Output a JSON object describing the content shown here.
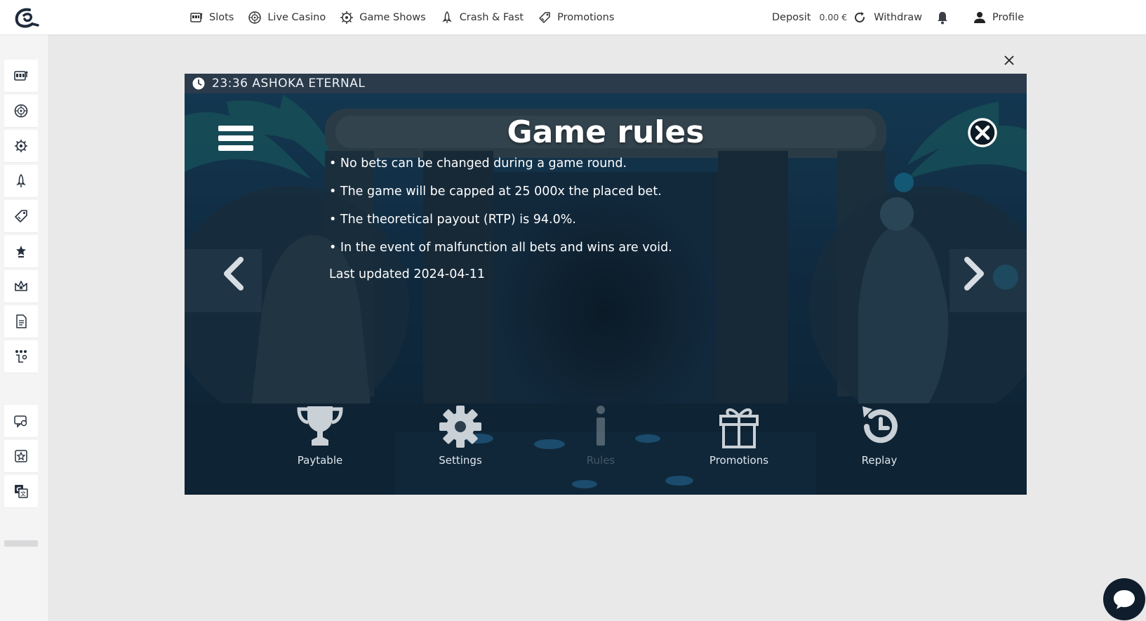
{
  "topnav": {
    "logo_icon": "brand-logo-icon",
    "items": [
      {
        "label": "Slots",
        "icon": "slot-machine-icon"
      },
      {
        "label": "Live Casino",
        "icon": "roulette-icon"
      },
      {
        "label": "Game Shows",
        "icon": "wheel-icon"
      },
      {
        "label": "Crash & Fast",
        "icon": "rocket-icon"
      },
      {
        "label": "Promotions",
        "icon": "promo-tag-icon"
      }
    ],
    "deposit_label": "Deposit",
    "balance": "0.00 €",
    "withdraw_label": "Withdraw",
    "profile_label": "Profile"
  },
  "sidebar": {
    "icons": [
      "slot-machine-icon",
      "roulette-icon",
      "wheel-icon",
      "rocket-icon",
      "promo-tag-icon",
      "star-trophy-icon",
      "crown-icon",
      "document-icon",
      "tournament-icon",
      "chat-support-icon",
      "vip-badge-icon",
      "translate-icon"
    ]
  },
  "game": {
    "header_time_title": "23:36 ASHOKA ETERNAL",
    "rules_title": "Game rules",
    "rules": [
      "• No bets can be changed during a game round.",
      "• The game will be capped at 25 000x the placed bet.",
      "• The theoretical payout (RTP) is 94.0%.",
      "• In the event of malfunction all bets and wins are void."
    ],
    "last_updated": "Last updated 2024-04-11",
    "menu": [
      {
        "label": "Paytable",
        "icon": "trophy-icon",
        "enabled": true
      },
      {
        "label": "Settings",
        "icon": "gear-icon",
        "enabled": true
      },
      {
        "label": "Rules",
        "icon": "info-icon",
        "enabled": false
      },
      {
        "label": "Promotions",
        "icon": "gift-icon",
        "enabled": true
      },
      {
        "label": "Replay",
        "icon": "replay-icon",
        "enabled": true
      }
    ]
  },
  "colors": {
    "header_bar": "#2b3b4b",
    "page_bg": "#e9e9ea",
    "chat_button": "#101d2d"
  }
}
